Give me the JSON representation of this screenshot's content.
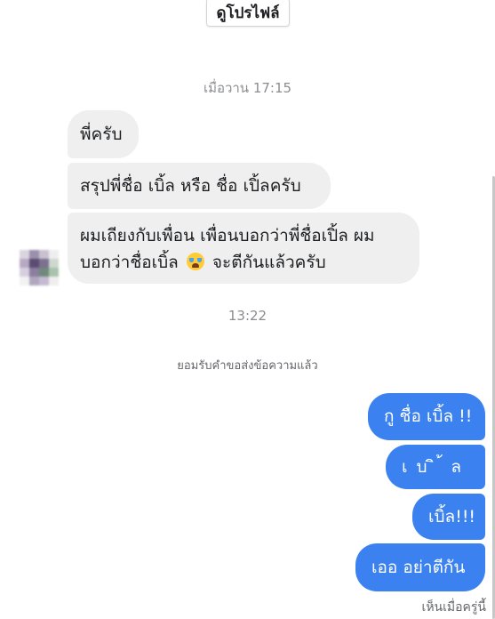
{
  "header": {
    "view_profile_label": "ดูโปรไฟล์"
  },
  "thread": {
    "timestamp_1": "เมื่อวาน 17:15",
    "incoming": [
      "พี่ครับ",
      "สรุปพี่ชื่อ เบิ้ล หรือ ชื่อ เปิ้ลครับ"
    ],
    "incoming_long": {
      "line1": "ผมเถียงกับเพื่อน เพื่อนบอกว่าพี่ชื่อเปิ้ล ผม",
      "line2_before": "บอกว่าชื่อเบิ้ล",
      "emoji": "crying-face-emoji",
      "line2_after": "จะตีกันแล้วครับ"
    },
    "timestamp_2": "13:22",
    "system_notice": "ยอมรับคำขอส่งข้อความแล้ว",
    "outgoing": [
      "กู ชื่อ เบิ้ล !!",
      "เ บ ิ ้ ล",
      "เบิ้ล!!!",
      "เออ อย่าตีกัน"
    ],
    "seen_status": "เห็นเมื่อครู่นี้"
  },
  "colors": {
    "outgoing_bubble": "#3b82f0",
    "incoming_bubble": "#efefef",
    "timestamp_text": "#8a8d91"
  }
}
